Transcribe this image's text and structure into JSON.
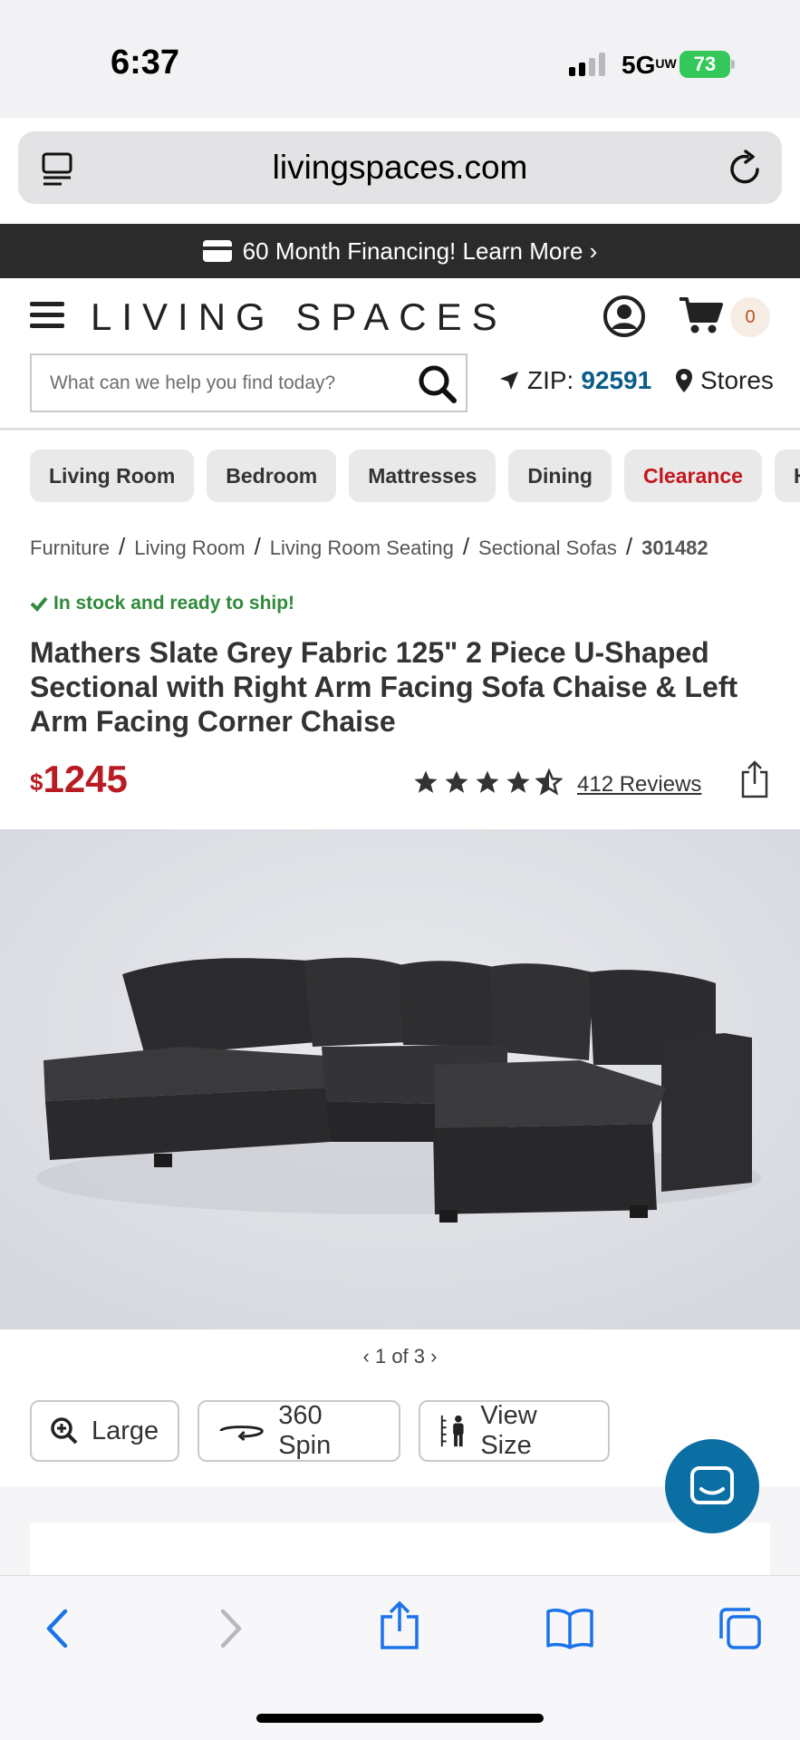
{
  "status_bar": {
    "time": "6:37",
    "network": "5G",
    "network_sup": "UW",
    "battery": "73"
  },
  "browser": {
    "url": "livingspaces.com"
  },
  "promo": {
    "text": "60 Month Financing! Learn More ›"
  },
  "header": {
    "logo": "LIVING SPACES",
    "cart_count": "0",
    "search_placeholder": "What can we help you find today?",
    "zip_label": "ZIP:",
    "zip_value": "92591",
    "stores_label": "Stores"
  },
  "categories": [
    "Living Room",
    "Bedroom",
    "Mattresses",
    "Dining",
    "Clearance",
    "Home Decor"
  ],
  "breadcrumbs": [
    "Furniture",
    "Living Room",
    "Living Room Seating",
    "Sectional Sofas",
    "301482"
  ],
  "product": {
    "stock": "In stock and ready to ship!",
    "title": "Mathers Slate Grey Fabric 125\" 2 Piece U-Shaped Sectional with Right Arm Facing Sofa Chaise & Left Arm Facing Corner Chaise",
    "currency": "$",
    "price": "1245",
    "rating": 4.5,
    "reviews": "412 Reviews",
    "pager": "1 of 3"
  },
  "media_buttons": {
    "large": "Large",
    "spin": "360 Spin",
    "size": "View Size"
  },
  "colors": {
    "accent_blue": "#0b6fa4",
    "price_red": "#b81c22",
    "stock_green": "#2f8a3b",
    "safari_blue": "#1a73e8"
  }
}
